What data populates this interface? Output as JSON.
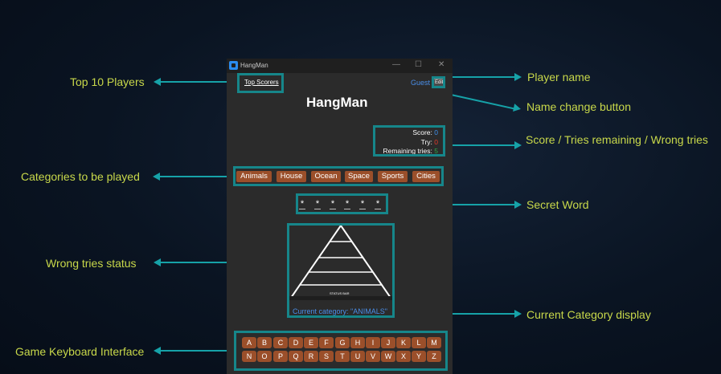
{
  "annotations": {
    "top10": "Top 10 Players",
    "categories": "Categories to be played",
    "wrong_status": "Wrong tries status",
    "keyboard": "Game Keyboard Interface",
    "player_name": "Player name",
    "name_change": "Name change button",
    "score_tries": "Score / Tries remaining / Wrong tries",
    "secret_word": "Secret Word",
    "current_category": "Current Category display"
  },
  "window": {
    "title": "HangMan",
    "minimize": "—",
    "maximize": "☐",
    "close": "✕"
  },
  "app": {
    "top_scorers": "Top Scorers",
    "player": "Guest",
    "edit_label": "Edit",
    "heading": "HangMan",
    "score_label": "Score:",
    "score_value": "0",
    "try_label": "Try:",
    "try_value": "0",
    "remaining_label": "Remaining tries:",
    "remaining_value": "5",
    "categories": [
      "Animals",
      "House",
      "Ocean",
      "Space",
      "Sports",
      "Cities"
    ],
    "secret_mask": [
      "*",
      "*",
      "*",
      "*",
      "*",
      "*"
    ],
    "status_bar_label": "STATUS BAR",
    "current_category": "Current category: \"ANIMALS\"",
    "keyboard_row1": [
      "A",
      "B",
      "C",
      "D",
      "E",
      "F",
      "G",
      "H",
      "I",
      "J",
      "K",
      "L",
      "M"
    ],
    "keyboard_row2": [
      "N",
      "O",
      "P",
      "Q",
      "R",
      "S",
      "T",
      "U",
      "V",
      "W",
      "X",
      "Y",
      "Z"
    ]
  },
  "colors": {
    "accent_teal": "#16a2a8",
    "annotation_text": "#c8d84a",
    "button_brown": "#9b4f2a",
    "link_blue": "#4a8ee8",
    "score_blue": "#3f8fe8",
    "try_red": "#e03a2a",
    "remaining_green": "#2ea84a"
  },
  "icons": {
    "app": "app-icon"
  }
}
